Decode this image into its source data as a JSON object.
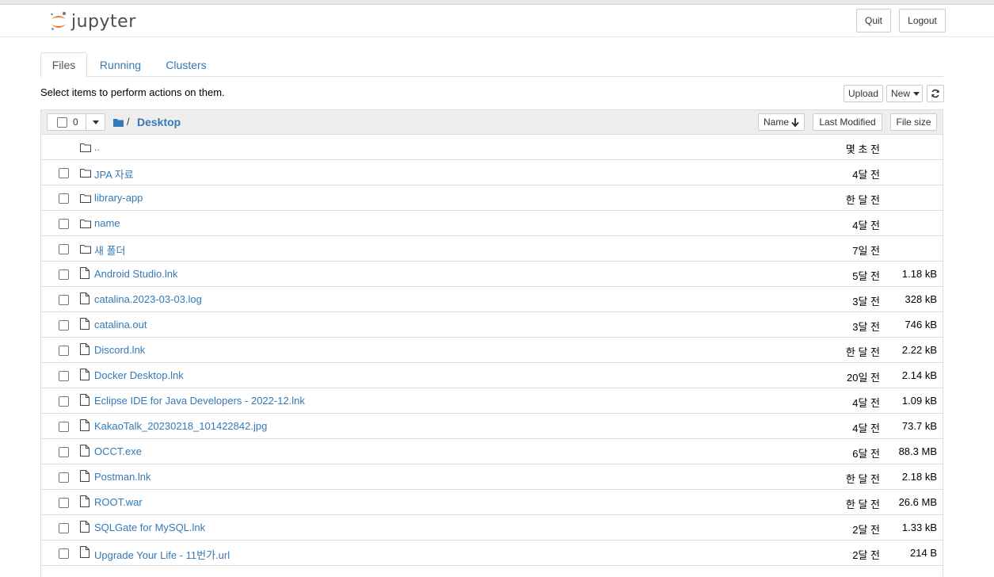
{
  "header": {
    "app_name": "jupyter",
    "quit_label": "Quit",
    "logout_label": "Logout"
  },
  "tabs": [
    {
      "label": "Files",
      "active": true
    },
    {
      "label": "Running",
      "active": false
    },
    {
      "label": "Clusters",
      "active": false
    }
  ],
  "toolbar": {
    "tip": "Select items to perform actions on them.",
    "upload_label": "Upload",
    "new_label": "New"
  },
  "list_header": {
    "selected_count": "0",
    "breadcrumb_sep": "/",
    "breadcrumb_folder": "Desktop",
    "sort_name_label": "Name",
    "sort_modified_label": "Last Modified",
    "sort_size_label": "File size"
  },
  "colors": {
    "link": "#337ab7",
    "logo_orange": "#f37726",
    "header_bg": "#eeeeee"
  },
  "items": [
    {
      "type": "folder",
      "name": "..",
      "modified": "몇 초 전",
      "size": "",
      "checkbox": false
    },
    {
      "type": "folder",
      "name": "JPA 자료",
      "modified": "4달 전",
      "size": "",
      "checkbox": true
    },
    {
      "type": "folder",
      "name": "library-app",
      "modified": "한 달 전",
      "size": "",
      "checkbox": true
    },
    {
      "type": "folder",
      "name": "name",
      "modified": "4달 전",
      "size": "",
      "checkbox": true
    },
    {
      "type": "folder",
      "name": "새 폴더",
      "modified": "7일 전",
      "size": "",
      "checkbox": true
    },
    {
      "type": "file",
      "name": "Android Studio.lnk",
      "modified": "5달 전",
      "size": "1.18 kB",
      "checkbox": true
    },
    {
      "type": "file",
      "name": "catalina.2023-03-03.log",
      "modified": "3달 전",
      "size": "328 kB",
      "checkbox": true
    },
    {
      "type": "file",
      "name": "catalina.out",
      "modified": "3달 전",
      "size": "746 kB",
      "checkbox": true
    },
    {
      "type": "file",
      "name": "Discord.lnk",
      "modified": "한 달 전",
      "size": "2.22 kB",
      "checkbox": true
    },
    {
      "type": "file",
      "name": "Docker Desktop.lnk",
      "modified": "20일 전",
      "size": "2.14 kB",
      "checkbox": true
    },
    {
      "type": "file",
      "name": "Eclipse IDE for Java Developers - 2022-12.lnk",
      "modified": "4달 전",
      "size": "1.09 kB",
      "checkbox": true
    },
    {
      "type": "file",
      "name": "KakaoTalk_20230218_101422842.jpg",
      "modified": "4달 전",
      "size": "73.7 kB",
      "checkbox": true
    },
    {
      "type": "file",
      "name": "OCCT.exe",
      "modified": "6달 전",
      "size": "88.3 MB",
      "checkbox": true
    },
    {
      "type": "file",
      "name": "Postman.lnk",
      "modified": "한 달 전",
      "size": "2.18 kB",
      "checkbox": true
    },
    {
      "type": "file",
      "name": "ROOT.war",
      "modified": "한 달 전",
      "size": "26.6 MB",
      "checkbox": true
    },
    {
      "type": "file",
      "name": "SQLGate for MySQL.lnk",
      "modified": "2달 전",
      "size": "1.33 kB",
      "checkbox": true
    },
    {
      "type": "file",
      "name": "Upgrade Your Life - 11번가.url",
      "modified": "2달 전",
      "size": "214 B",
      "checkbox": true
    }
  ]
}
